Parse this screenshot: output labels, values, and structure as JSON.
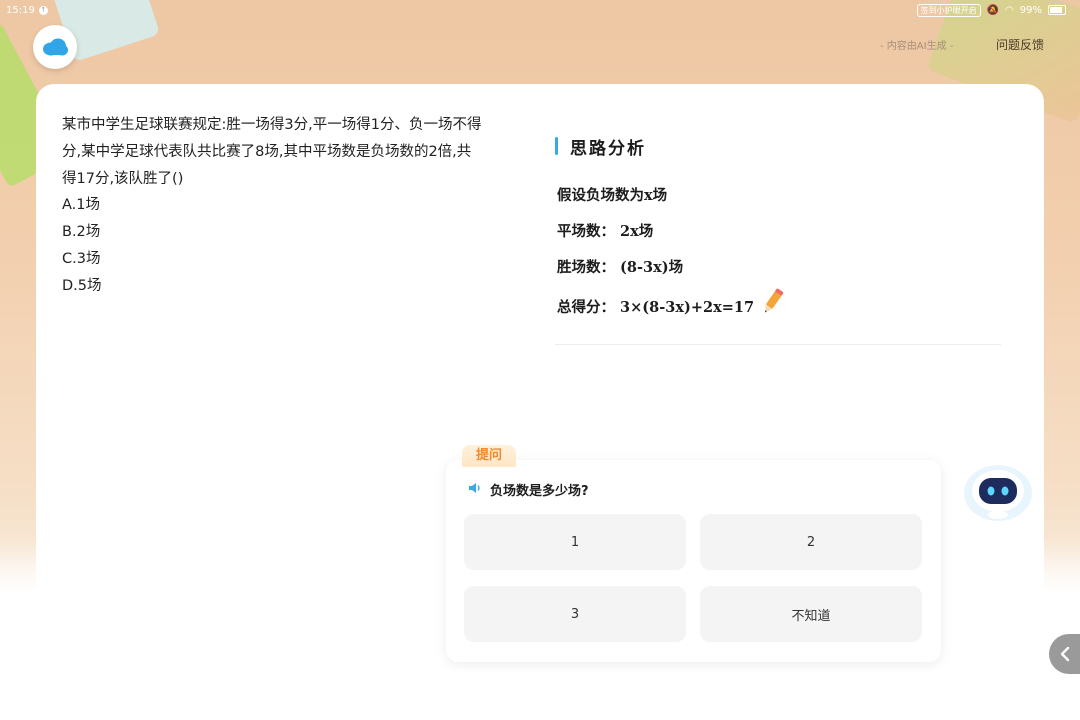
{
  "status_bar": {
    "time": "15:19",
    "chip": "签到小护眼开启",
    "battery": "99%"
  },
  "header": {
    "logo_icon": "cloud-icon",
    "ai_note": "- 内容由AI生成 -",
    "feedback": "问题反馈"
  },
  "question": {
    "text": "某市中学生足球联赛规定:胜一场得3分,平一场得1分、负一场不得分,某中学足球代表队共比赛了8场,其中平场数是负场数的2倍,共得17分,该队胜了()",
    "options": [
      "A.1场",
      "B.2场",
      "C.3场",
      "D.5场"
    ]
  },
  "analysis": {
    "title": "思路分析",
    "lines": [
      "假设负场数为x场",
      "平场数： 2x场",
      "胜场数： (8-3x)场",
      "总得分： 3×(8-3x)+2x=17"
    ],
    "accent_color": "#3aa8e4"
  },
  "ask": {
    "tag": "提问",
    "question": "负场数是多少场?",
    "answers": [
      "1",
      "2",
      "3",
      "不知道"
    ]
  },
  "colors": {
    "tag_text": "#ef8a2f",
    "answer_bg": "#f4f4f5"
  }
}
